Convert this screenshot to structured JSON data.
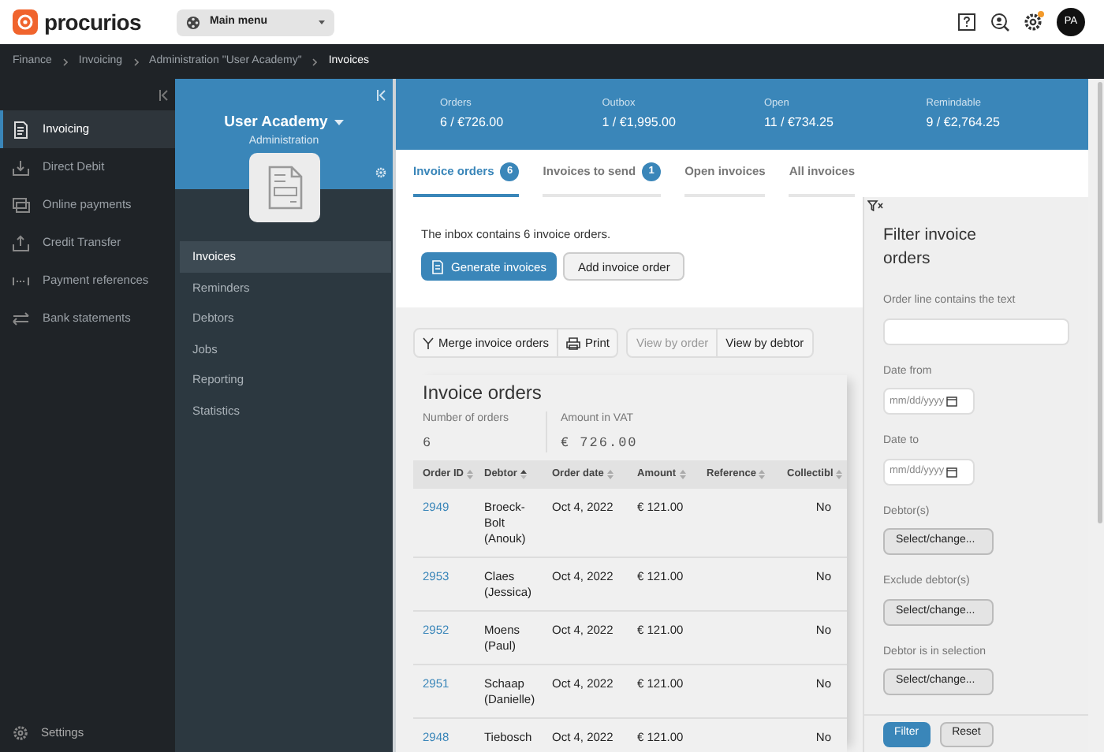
{
  "header": {
    "logo": "procurios",
    "main_menu": "Main menu",
    "avatar": "PA",
    "settings_notification": true
  },
  "breadcrumb": [
    {
      "label": "Finance",
      "current": false
    },
    {
      "label": "Invoicing",
      "current": false
    },
    {
      "label": "Administration \"User Academy\"",
      "current": false
    },
    {
      "label": "Invoices",
      "current": true
    }
  ],
  "sidebar": {
    "items": [
      {
        "label": "Invoicing",
        "selected": true
      },
      {
        "label": "Direct Debit",
        "selected": false
      },
      {
        "label": "Online payments",
        "selected": false
      },
      {
        "label": "Credit Transfer",
        "selected": false
      },
      {
        "label": "Payment references",
        "selected": false
      },
      {
        "label": "Bank statements",
        "selected": false
      }
    ],
    "footer": "Settings"
  },
  "administration": {
    "title": "User Academy",
    "subtitle": "Administration",
    "menu": [
      {
        "label": "Invoices",
        "selected": true
      },
      {
        "label": "Reminders",
        "selected": false
      },
      {
        "label": "Debtors",
        "selected": false
      },
      {
        "label": "Jobs",
        "selected": false
      },
      {
        "label": "Reporting",
        "selected": false
      },
      {
        "label": "Statistics",
        "selected": false
      }
    ]
  },
  "stats": [
    {
      "label": "Orders",
      "value": "6 / €726.00"
    },
    {
      "label": "Outbox",
      "value": "1 / €1,995.00"
    },
    {
      "label": "Open",
      "value": "11 / €734.25"
    },
    {
      "label": "Remindable",
      "value": "9 / €2,764.25"
    }
  ],
  "tabs": [
    {
      "label": "Invoice orders",
      "badge": "6",
      "selected": true
    },
    {
      "label": "Invoices to send",
      "badge": "1",
      "selected": false
    },
    {
      "label": "Open invoices",
      "selected": false
    },
    {
      "label": "All invoices",
      "selected": false
    }
  ],
  "inbox": {
    "text": "The inbox contains 6 invoice orders.",
    "primary_button": "Generate invoices",
    "secondary_button": "Add invoice order"
  },
  "toolbar": {
    "actions": [
      "Merge invoice orders",
      "Print"
    ],
    "views": [
      {
        "label": "View by order",
        "selected": true
      },
      {
        "label": "View by debtor",
        "selected": false
      }
    ]
  },
  "orders": {
    "title": "Invoice orders",
    "summary": [
      {
        "label": "Number of orders",
        "value": "6"
      },
      {
        "label": "Amount in VAT",
        "value": "€ 726.00"
      }
    ],
    "columns": [
      {
        "label": "Order ID",
        "sorted": false
      },
      {
        "label": "Debtor",
        "sorted": true
      },
      {
        "label": "Order date",
        "sorted": false
      },
      {
        "label": "Amount",
        "sorted": false
      },
      {
        "label": "Reference",
        "sorted": false
      },
      {
        "label": "Collectibl",
        "sorted": false
      }
    ],
    "rows": [
      [
        "2949",
        "Broeck-Bolt (Anouk)",
        "Oct 4, 2022",
        "€ 121.00",
        "",
        "No"
      ],
      [
        "2953",
        "Claes (Jessica)",
        "Oct 4, 2022",
        "€ 121.00",
        "",
        "No"
      ],
      [
        "2952",
        "Moens (Paul)",
        "Oct 4, 2022",
        "€ 121.00",
        "",
        "No"
      ],
      [
        "2951",
        "Schaap (Danielle)",
        "Oct 4, 2022",
        "€ 121.00",
        "",
        "No"
      ],
      [
        "2948",
        "Tiebosch",
        "Oct 4, 2022",
        "€ 121.00",
        "",
        "No"
      ]
    ]
  },
  "filter": {
    "title": "Filter invoice orders",
    "fields": [
      {
        "kind": "text",
        "label": "Order line contains the text"
      },
      {
        "kind": "date",
        "label": "Date from",
        "placeholder": "mm/dd/yyyy"
      },
      {
        "kind": "date",
        "label": "Date to",
        "placeholder": "mm/dd/yyyy"
      },
      {
        "kind": "select",
        "label": "Debtor(s)",
        "button": "Select/change..."
      },
      {
        "kind": "select",
        "label": "Exclude debtor(s)",
        "button": "Select/change..."
      },
      {
        "kind": "select",
        "label": "Debtor is in selection",
        "button": "Select/change..."
      }
    ],
    "apply": "Filter",
    "reset": "Reset"
  }
}
